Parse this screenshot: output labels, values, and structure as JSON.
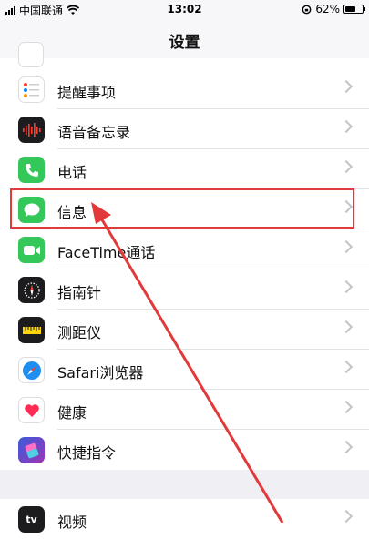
{
  "status": {
    "carrier": "中国联通",
    "time": "13:02",
    "battery": "62%",
    "battery_level": 0.62
  },
  "nav": {
    "title": "设置"
  },
  "rows": [
    {
      "label": "提醒事项",
      "icon": "reminders-icon"
    },
    {
      "label": "语音备忘录",
      "icon": "voice-memos-icon"
    },
    {
      "label": "电话",
      "icon": "phone-icon"
    },
    {
      "label": "信息",
      "icon": "messages-icon"
    },
    {
      "label": "FaceTime通话",
      "icon": "facetime-icon"
    },
    {
      "label": "指南针",
      "icon": "compass-icon"
    },
    {
      "label": "测距仪",
      "icon": "measure-icon"
    },
    {
      "label": "Safari浏览器",
      "icon": "safari-icon"
    },
    {
      "label": "健康",
      "icon": "health-icon"
    },
    {
      "label": "快捷指令",
      "icon": "shortcuts-icon"
    }
  ],
  "group2": [
    {
      "label": "视频",
      "icon": "tv-icon",
      "icon_text": "tv"
    }
  ],
  "colors": {
    "highlight": "#e23a3a",
    "arrow": "#e23a3a"
  }
}
